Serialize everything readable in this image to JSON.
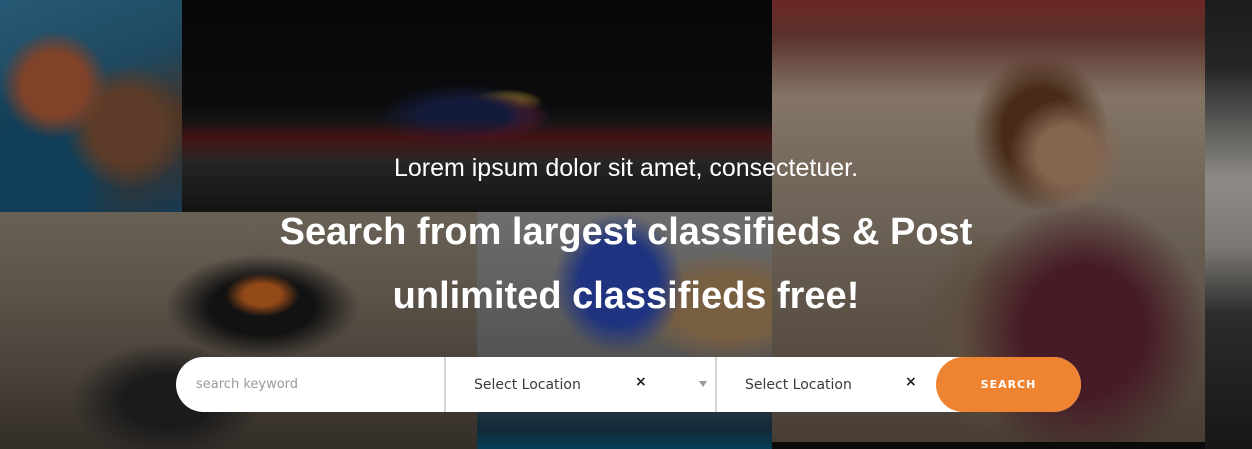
{
  "hero": {
    "tagline": "Lorem ipsum dolor sit amet, consectetuer.",
    "headline_line1": "Search from largest classifieds & Post",
    "headline_line2": "unlimited classifieds free!"
  },
  "search": {
    "keyword_placeholder": "search keyword",
    "location_select_1": "Select Location",
    "location_select_2": "Select Location",
    "clear_glyph": "×",
    "button_label": "SEARCH"
  },
  "colors": {
    "accent": "#ee8431",
    "text_light": "#ffffff",
    "bar_bg": "#ffffff"
  },
  "icons": {
    "clear": "close-icon",
    "dropdown": "chevron-down-icon"
  }
}
